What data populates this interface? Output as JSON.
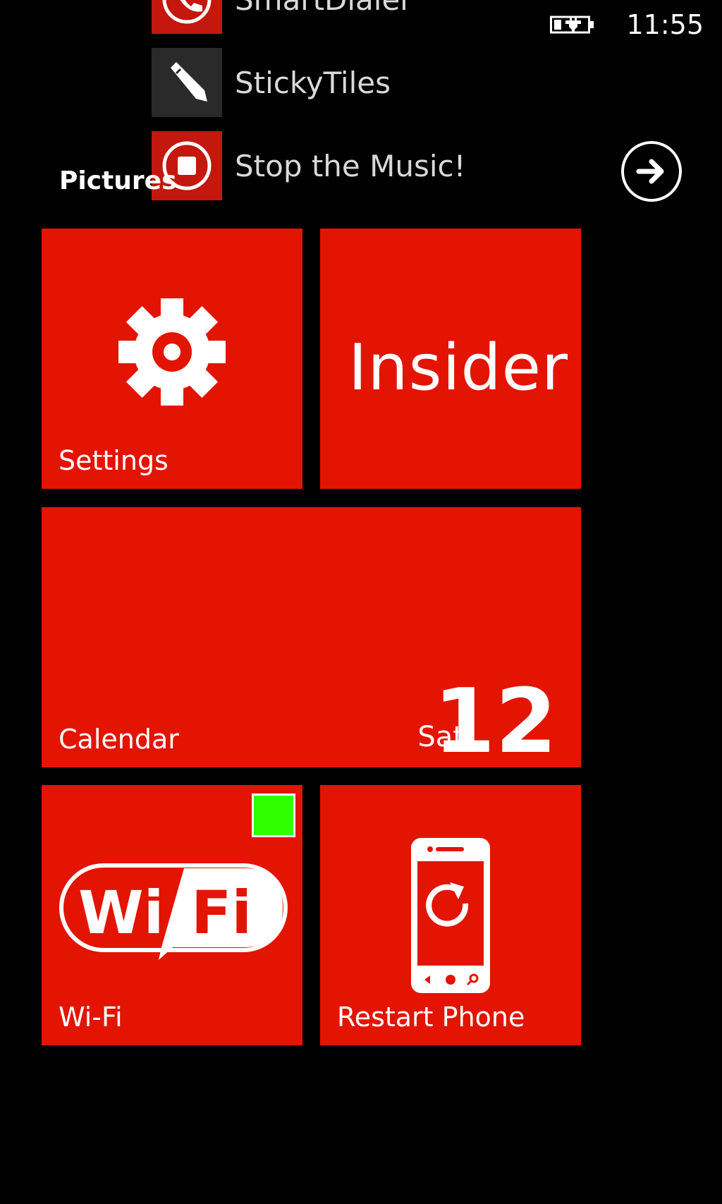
{
  "status_bar": {
    "time": "11:55",
    "battery_icon": "battery-charging-icon"
  },
  "app_list": {
    "items": [
      {
        "label": "SmartDialer",
        "icon": "phone-dialer-icon"
      },
      {
        "label": "StickyTiles",
        "icon": "pencil-icon"
      },
      {
        "label": "Stop the Music!",
        "icon": "stop-icon"
      }
    ]
  },
  "section": {
    "title": "Pictures",
    "arrow_icon": "arrow-right-icon"
  },
  "tiles": {
    "settings": {
      "label": "Settings",
      "icon": "gear-icon"
    },
    "insider": {
      "text": "Insider"
    },
    "calendar": {
      "label": "Calendar",
      "day": "Sat",
      "date": "12"
    },
    "wifi": {
      "label": "Wi-Fi",
      "logo_icon": "wifi-logo-icon",
      "status_color": "#2fff00"
    },
    "restart": {
      "label": "Restart Phone",
      "icon": "restart-phone-icon"
    }
  },
  "colors": {
    "accent": "#e31402",
    "background": "#000000"
  }
}
